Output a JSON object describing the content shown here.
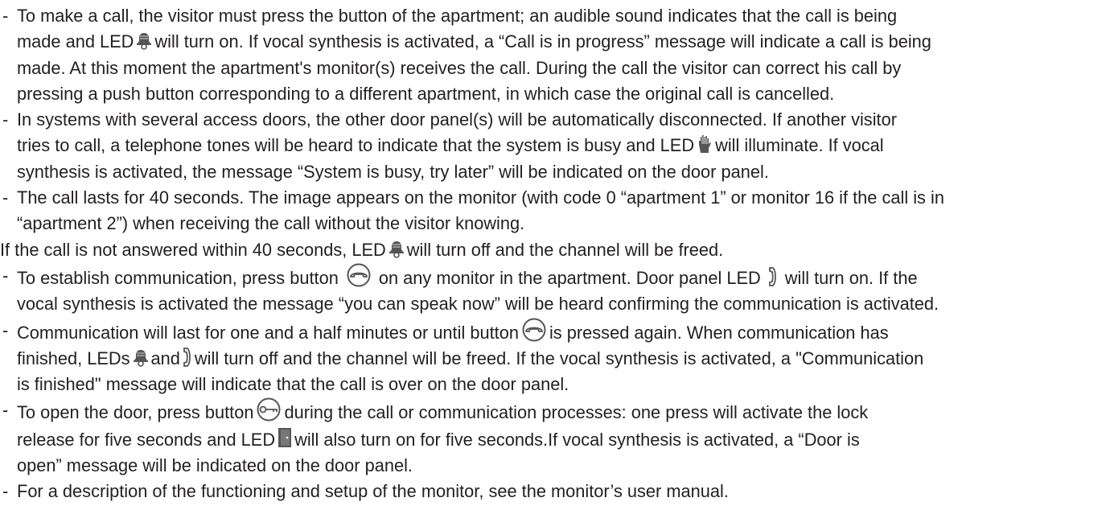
{
  "paragraphs": [
    {
      "lines": [
        {
          "a": "To make a call, the visitor must press the button of the apartment; an audible sound indicates that the call is being"
        },
        {
          "a": "made and LED",
          "icon": "bell-icon",
          "b": "will turn on. If vocal synthesis is activated, a “Call is in progress” message will indicate a call is being"
        },
        {
          "a": "made. At this moment the apartment's monitor(s) receives the call. During the call the visitor can correct his call by"
        },
        {
          "a": "pressing a push button corresponding to a different apartment, in which case the original call is cancelled."
        }
      ]
    },
    {
      "lines": [
        {
          "a": "In systems with several access doors, the other door panel(s) will be automatically disconnected. If another visitor"
        },
        {
          "a": "tries to call, a telephone tones will be heard to indicate that the system is busy and LED",
          "icon": "hand-icon",
          "b": "will illuminate. If vocal"
        },
        {
          "a": "synthesis is activated, the message “System is busy, try later” will be indicated on the door panel."
        }
      ]
    },
    {
      "lines": [
        {
          "a": "The call lasts for 40 seconds. The image appears on the monitor (with code 0 “apartment 1” or monitor 16 if the call is in"
        },
        {
          "a": "“apartment 2”) when receiving the call without the visitor knowing."
        },
        {
          "a": "If the call is not answered within 40 seconds, LED",
          "icon": "bell-icon",
          "b": "will turn off and the channel will be freed."
        }
      ]
    },
    {
      "lines": [
        {
          "a": "To establish communication, press button",
          "icon": "handset-button-icon",
          "b": "on any monitor in the apartment. Door panel LED",
          "icon2": "handset-icon",
          "c": "will turn on. If the"
        },
        {
          "a": "vocal synthesis is activated the message “you can speak now” will be heard confirming the communication is activated."
        }
      ]
    },
    {
      "lines": [
        {
          "a": "Communication will last for one and a half minutes or until button",
          "icon": "handset-button-icon",
          "b": "is pressed again. When communication has"
        },
        {
          "a": "finished, LEDs",
          "icon": "bell-icon",
          "b": "and",
          "icon2": "handset-icon",
          "c": "will turn off and the channel will be freed. If the vocal synthesis is activated, a \"Communication"
        },
        {
          "a": "is finished\" message will indicate that the call is over on the door panel."
        }
      ]
    },
    {
      "lines": [
        {
          "a": "To open the door, press button",
          "icon": "key-button-icon",
          "b": "during the call or communication processes: one press will activate the lock"
        },
        {
          "a": "release for five seconds and LED",
          "icon": "door-icon",
          "b": "will also turn on for five seconds.If vocal synthesis is activated, a “Door is"
        },
        {
          "a": "open” message will be indicated on the door panel."
        }
      ]
    },
    {
      "lines": [
        {
          "a": "For a description of the functioning and setup of the monitor, see the monitor’s user manual."
        }
      ]
    }
  ],
  "dash": "-"
}
